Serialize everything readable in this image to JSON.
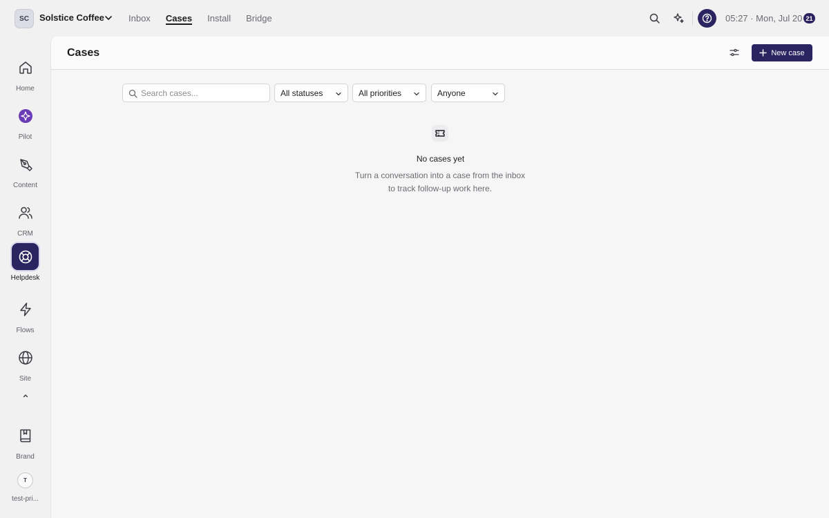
{
  "workspace": {
    "initials": "SC",
    "name": "Solstice Coffee"
  },
  "topnav": [
    {
      "label": "Inbox",
      "active": false
    },
    {
      "label": "Cases",
      "active": true
    },
    {
      "label": "Install",
      "active": false
    },
    {
      "label": "Bridge",
      "active": false
    }
  ],
  "status": {
    "time": "05:27",
    "separator": "·",
    "date": "Mon, Jul 20",
    "badge": "21"
  },
  "sidebar": {
    "items": [
      {
        "label": "Home",
        "icon": "home-icon"
      },
      {
        "label": "Pilot",
        "icon": "pilot-icon"
      },
      {
        "label": "Content",
        "icon": "pen-icon"
      },
      {
        "label": "CRM",
        "icon": "users-icon"
      },
      {
        "label": "Helpdesk",
        "icon": "lifebuoy-icon",
        "active": true
      },
      {
        "label": "Flows",
        "icon": "lightning-icon"
      },
      {
        "label": "Site",
        "icon": "globe-icon"
      }
    ],
    "bottom": [
      {
        "label": "Brand",
        "icon": "book-icon"
      },
      {
        "label": "test-pri...",
        "avatar": "T"
      }
    ]
  },
  "page": {
    "title": "Cases",
    "new_button": "New case"
  },
  "filters": {
    "search_placeholder": "Search cases...",
    "status": "All statuses",
    "priority": "All priorities",
    "assignee": "Anyone"
  },
  "empty_state": {
    "icon": "ticket-icon",
    "title": "No cases yet",
    "description": "Turn a conversation into a case from the inbox to track follow-up work here."
  },
  "colors": {
    "accent": "#2b2461",
    "pilot": "#6a3bb5",
    "background": "#f1f1f1"
  }
}
